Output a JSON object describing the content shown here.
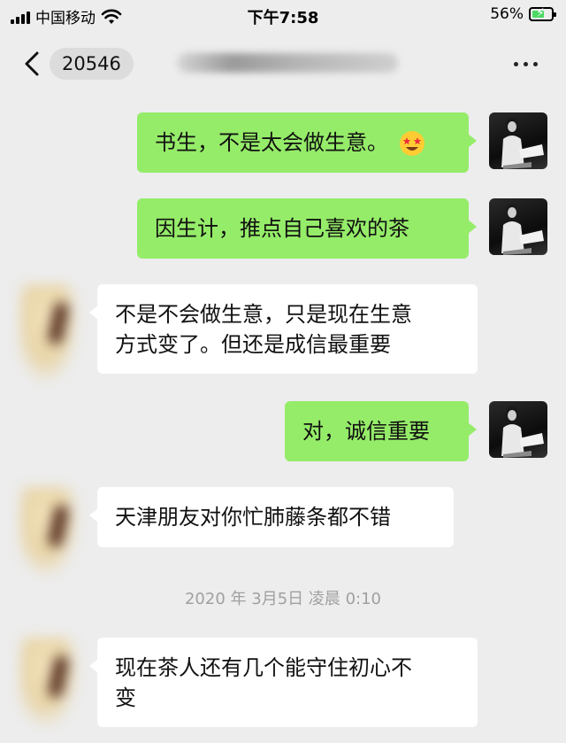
{
  "status_bar": {
    "carrier": "中国移动",
    "time": "下午7:58",
    "battery_percent": "56%",
    "battery_level": 0.56,
    "icons": [
      "signal-icon",
      "wifi-icon",
      "battery-charging-icon"
    ]
  },
  "nav": {
    "back_icon": "chevron-left-icon",
    "title": "20546",
    "more_icon": "more-dots-icon"
  },
  "messages": [
    {
      "sender": "me",
      "text": "书生，不是太会做生意。",
      "emoji": "star-struck-emoji"
    },
    {
      "sender": "me",
      "text": "因生计，推点自己喜欢的茶"
    },
    {
      "sender": "other",
      "line1": "不是不会做生意，只是现在生意",
      "line2": "方式变了。但还是成信最重要"
    },
    {
      "sender": "me",
      "text": "对，诚信重要"
    },
    {
      "sender": "other",
      "text": "天津朋友对你忙肺藤条都不错"
    },
    {
      "sender": "other",
      "line1": "现在茶人还有几个能守住初心不",
      "line2": "变"
    }
  ],
  "timestamp": "2020 年 3月5日 凌晨 0:10",
  "colors": {
    "background": "#ededed",
    "my_bubble": "#95ec69",
    "their_bubble": "#ffffff",
    "timestamp_text": "#a0a0a0"
  }
}
